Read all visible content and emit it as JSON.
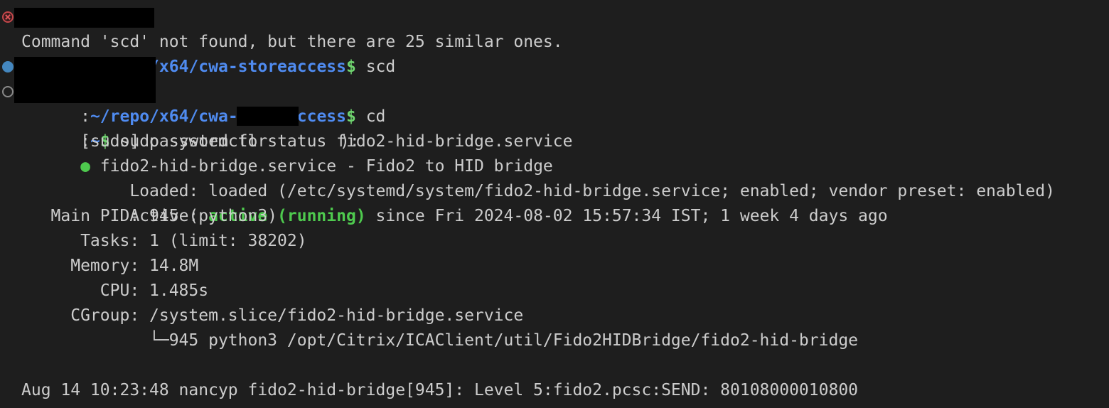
{
  "terminal": {
    "background_color": "#1e1e1e",
    "foreground_color": "#cccccc",
    "accent_green": "#4ec94e",
    "accent_blue": "#4f8bf0",
    "error_red": "#c4474a",
    "decoration_blue": "#4487bf",
    "decoration_gray": "#8a8a8a",
    "redaction_color": "#000000"
  },
  "lines": {
    "l1_prompt_host": "",
    "l1_colon": ":",
    "l1_path": "~/repo/x64/cwa-storeaccess",
    "l1_dollar": "$",
    "l1_command": " scd",
    "l2": "Command 'scd' not found, but there are 25 similar ones.",
    "l3_colon": ":",
    "l3_path": "~/repo/x64/cwa-storeaccess",
    "l3_dollar": "$",
    "l3_command": " cd",
    "l4_colon": ":",
    "l4_path": "~",
    "l4_dollar": "$",
    "l4_command": " sudo systemctl status fido2-hid-bridge.service",
    "l5_prefix": "[sudo] password for ",
    "l5_suffix": "):",
    "l6_bullet": "●",
    "l6_text": " fido2-hid-bridge.service - Fido2 to HID bridge",
    "l7_label": "     Loaded: ",
    "l7_value": "loaded (/etc/systemd/system/fido2-hid-bridge.service; enabled; vendor preset: enabled)",
    "l8_label": "     Active: ",
    "l8_state": "active (running)",
    "l8_rest": " since Fri 2024-08-02 15:57:34 IST; 1 week 4 days ago",
    "l9": "   Main PID: 945 (python3)",
    "l10": "      Tasks: 1 (limit: 38202)",
    "l11": "     Memory: 14.8M",
    "l12": "        CPU: 1.485s",
    "l13": "     CGroup: /system.slice/fido2-hid-bridge.service",
    "l14": "             └─945 python3 /opt/Citrix/ICAClient/util/Fido2HIDBridge/fido2-hid-bridge",
    "l15": "",
    "l16": "Aug 14 10:23:48 nancyp fido2-hid-bridge[945]: Level 5:fido2.pcsc:SEND: 80108000010800"
  },
  "decorations": [
    {
      "name": "command-failed-marker",
      "type": "error-circle-x"
    },
    {
      "name": "command-succeeded-marker",
      "type": "filled-circle"
    },
    {
      "name": "command-no-exit-code-marker",
      "type": "outline-circle"
    }
  ],
  "redactions": [
    {
      "name": "username-redaction-line-1"
    },
    {
      "name": "username-redaction-line-3-4"
    },
    {
      "name": "username-redaction-sudo-prompt"
    }
  ]
}
